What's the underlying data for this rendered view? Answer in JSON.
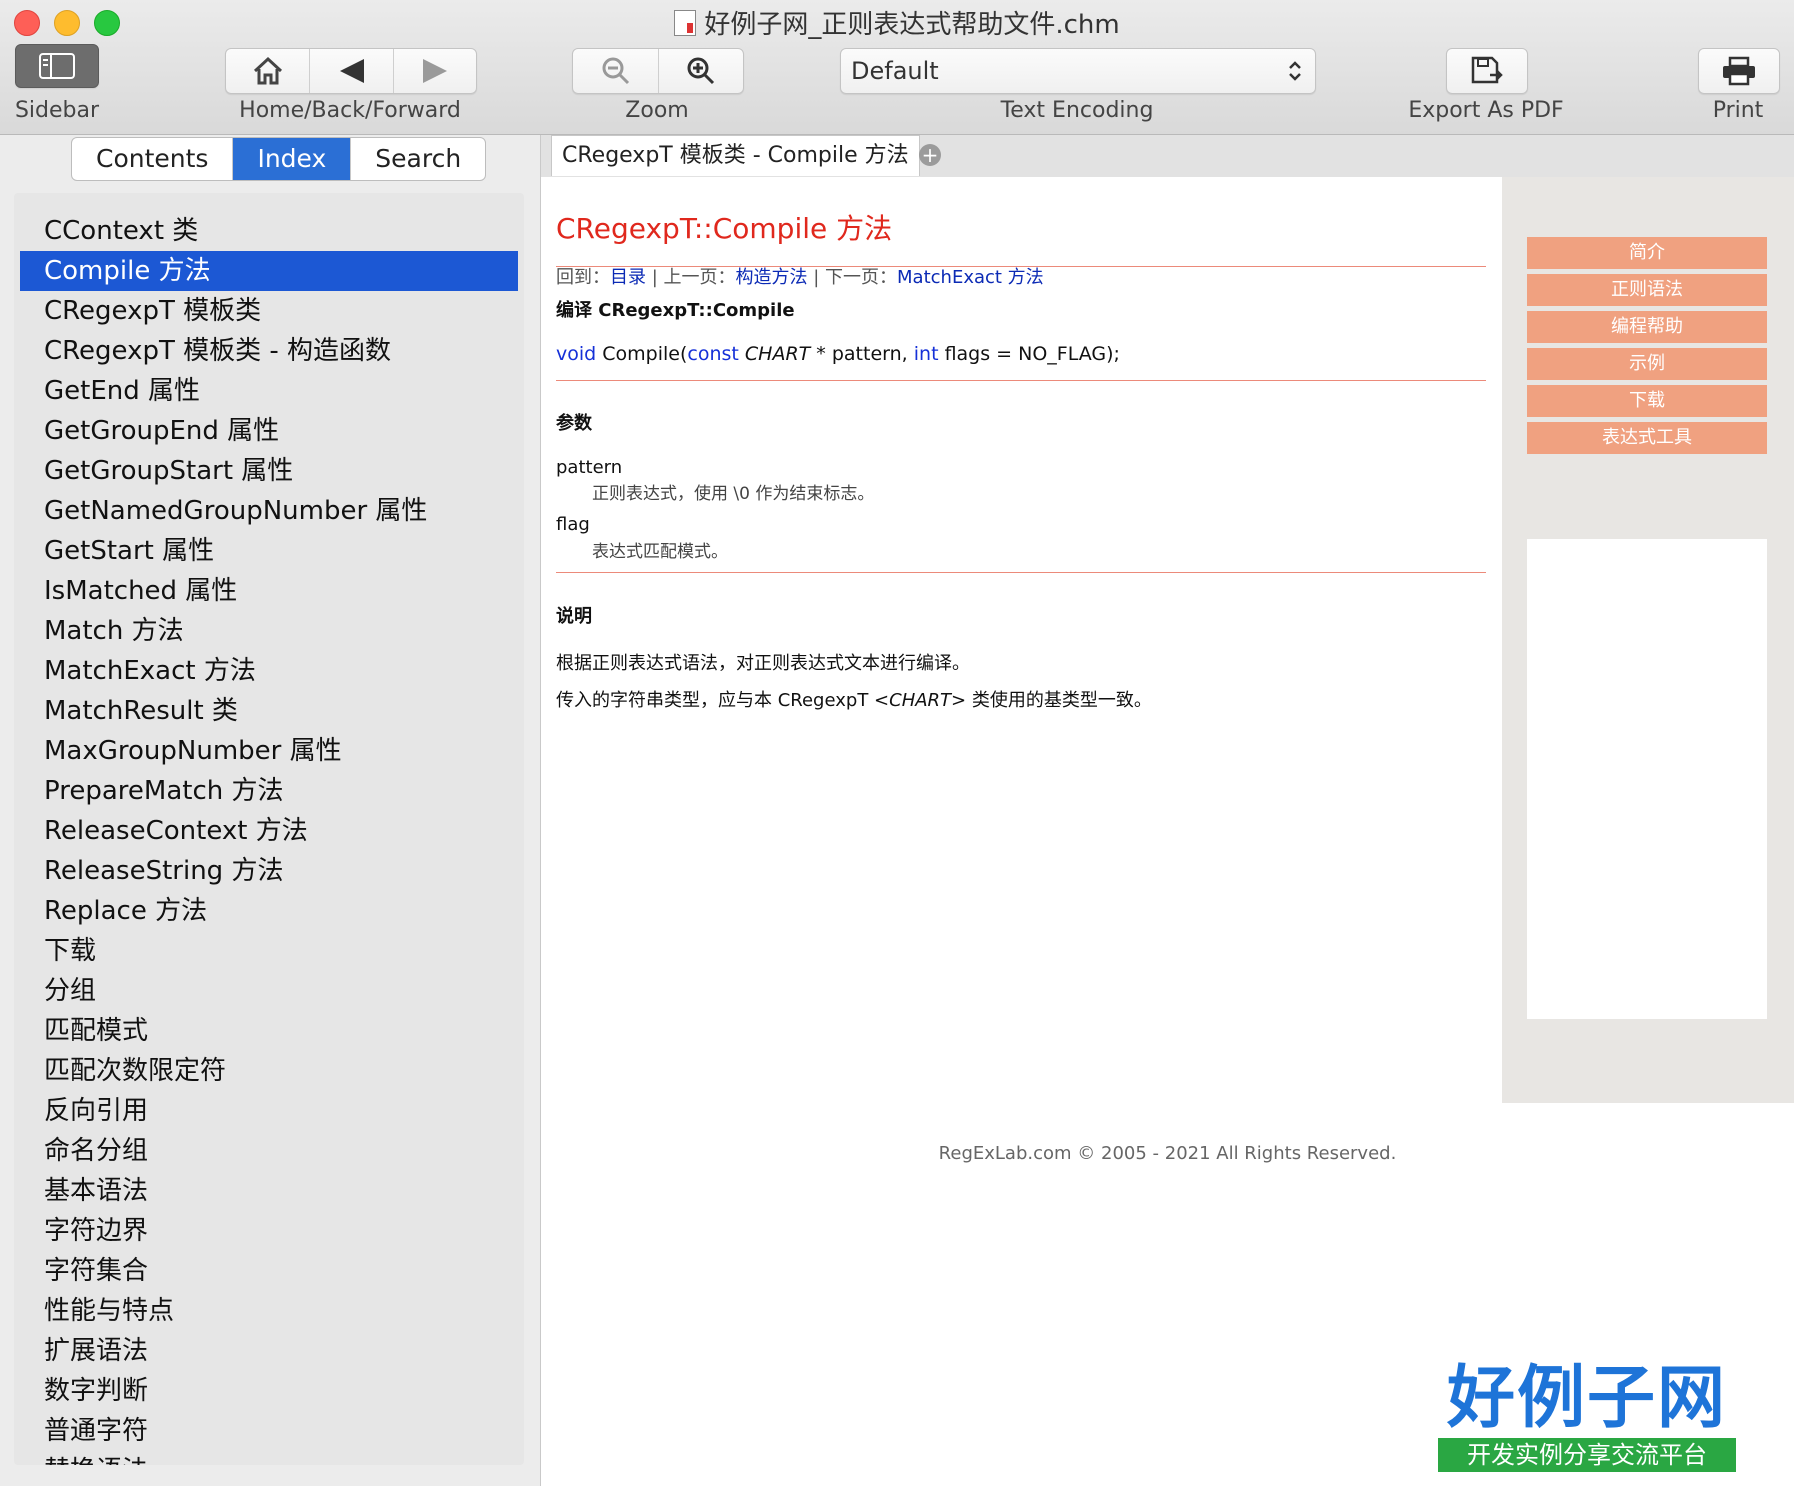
{
  "window": {
    "title": "好例子网_正则表达式帮助文件.chm"
  },
  "toolbar": {
    "sidebar_label": "Sidebar",
    "home_back_forward_label": "Home/Back/Forward",
    "zoom_label": "Zoom",
    "encoding_value": "Default",
    "encoding_label": "Text Encoding",
    "export_label": "Export As PDF",
    "print_label": "Print"
  },
  "sidebar": {
    "tabs": [
      "Contents",
      "Index",
      "Search"
    ],
    "items": [
      "CContext 类",
      "Compile 方法",
      "CRegexpT 模板类",
      "CRegexpT 模板类 - 构造函数",
      "GetEnd 属性",
      "GetGroupEnd 属性",
      "GetGroupStart 属性",
      "GetNamedGroupNumber 属性",
      "GetStart 属性",
      "IsMatched 属性",
      "Match 方法",
      "MatchExact 方法",
      "MatchResult 类",
      "MaxGroupNumber 属性",
      "PrepareMatch 方法",
      "ReleaseContext 方法",
      "ReleaseString 方法",
      "Replace 方法",
      "下载",
      "分组",
      "匹配模式",
      "匹配次数限定符",
      "反向引用",
      "命名分组",
      "基本语法",
      "字符边界",
      "字符集合",
      "性能与特点",
      "扩展语法",
      "数字判断",
      "普通字符",
      "替换语法"
    ]
  },
  "tab": {
    "title": "CRegexpT 模板类 - Compile 方法",
    "add_symbol": "+"
  },
  "page": {
    "title": "CRegexpT::Compile 方法",
    "crumb": {
      "back_label": "回到：",
      "back_link": "目录",
      "sep1": " | ",
      "prev_label": "上一页：",
      "prev_link": "构造方法",
      "sep2": " | ",
      "next_label": "下一页：",
      "next_link": "MatchExact 方法"
    },
    "compile_heading": "编译 CRegexpT::Compile",
    "code": {
      "void": "void",
      "fn": " Compile(",
      "const": "const",
      "chart": " CHART",
      "mid": " * pattern, ",
      "int": "int",
      "tail": " flags = NO_FLAG);"
    },
    "params_heading": "参数",
    "params": [
      {
        "name": "pattern",
        "desc": "正则表达式，使用 \\0 作为结束标志。"
      },
      {
        "name": "flag",
        "desc": "表达式匹配模式。"
      }
    ],
    "remarks_heading": "说明",
    "remarks1": "根据正则表达式语法，对正则表达式文本进行编译。",
    "remarks2_a": "传入的字符串类型，应与本 CRegexpT <",
    "remarks2_b": "CHART",
    "remarks2_c": "> 类使用的基类型一致。",
    "nav_buttons": [
      "简介",
      "正则语法",
      "编程帮助",
      "示例",
      "下载",
      "表达式工具"
    ],
    "footer": "RegExLab.com © 2005 - 2021  All Rights Reserved."
  },
  "watermark": {
    "logo": "好例子网",
    "tagline": "开发实例分享交流平台"
  },
  "colors": {
    "accent_blue": "#1c58d4",
    "title_red": "#e0281d",
    "nav_orange": "#f0a180",
    "divider": "#ec8a7a"
  }
}
